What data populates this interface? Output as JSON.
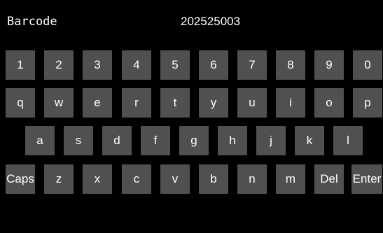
{
  "field": {
    "label": "Barcode",
    "value": "202525003"
  },
  "colors": {
    "background": "#000000",
    "key": "#505050",
    "text": "#ffffff"
  },
  "keyboard": {
    "rows": [
      [
        "1",
        "2",
        "3",
        "4",
        "5",
        "6",
        "7",
        "8",
        "9",
        "0"
      ],
      [
        "q",
        "w",
        "e",
        "r",
        "t",
        "y",
        "u",
        "i",
        "o",
        "p"
      ],
      [
        "a",
        "s",
        "d",
        "f",
        "g",
        "h",
        "j",
        "k",
        "l"
      ],
      [
        "Caps",
        "z",
        "x",
        "c",
        "v",
        "b",
        "n",
        "m",
        "Del",
        "Enter"
      ]
    ]
  }
}
